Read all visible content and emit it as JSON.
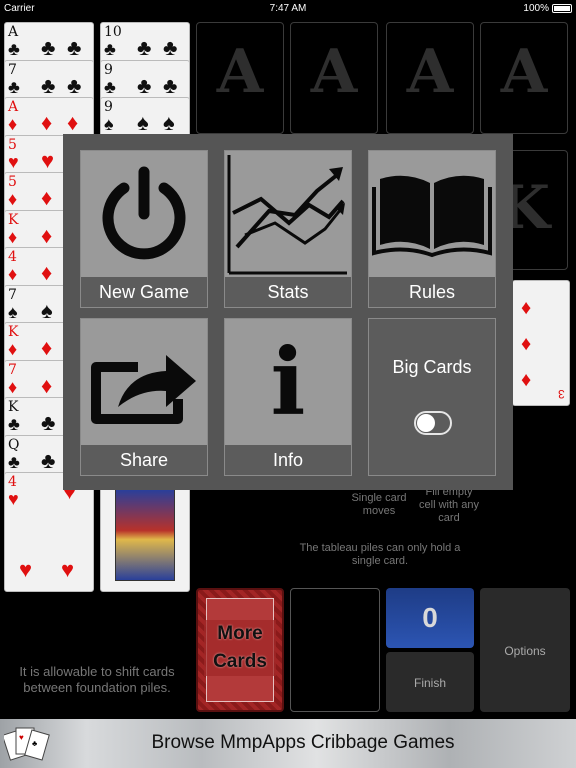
{
  "status_bar": {
    "carrier": "Carrier",
    "time": "7:47 AM",
    "battery": "100%"
  },
  "foundations": [
    "A",
    "A",
    "A",
    "A"
  ],
  "free_cells": [
    "K"
  ],
  "tableau": {
    "col1": [
      {
        "rank": "A",
        "suit": "♣",
        "color": "blk"
      },
      {
        "rank": "7",
        "suit": "♣",
        "color": "blk"
      },
      {
        "rank": "A",
        "suit": "♦",
        "color": "red"
      },
      {
        "rank": "5",
        "suit": "♥",
        "color": "red"
      },
      {
        "rank": "5",
        "suit": "♦",
        "color": "red"
      },
      {
        "rank": "K",
        "suit": "♦",
        "color": "red"
      },
      {
        "rank": "4",
        "suit": "♦",
        "color": "red"
      },
      {
        "rank": "7",
        "suit": "♠",
        "color": "blk"
      },
      {
        "rank": "K",
        "suit": "♦",
        "color": "red"
      },
      {
        "rank": "7",
        "suit": "♦",
        "color": "red"
      },
      {
        "rank": "K",
        "suit": "♣",
        "color": "blk"
      },
      {
        "rank": "Q",
        "suit": "♣",
        "color": "blk"
      },
      {
        "rank": "4",
        "suit": "♥",
        "color": "red"
      }
    ],
    "col2": [
      {
        "rank": "10",
        "suit": "♣",
        "color": "blk"
      },
      {
        "rank": "9",
        "suit": "♣",
        "color": "blk"
      },
      {
        "rank": "9",
        "suit": "♠",
        "color": "blk"
      }
    ],
    "right_card": {
      "rank": "3",
      "suit": "♦",
      "color": "red"
    }
  },
  "hints": {
    "single_card_moves": "Single card moves",
    "fill_empty": "Fill empty cell with any card",
    "tableau_rule": "The tableau piles can only hold a single card.",
    "foundation_shift": "It is allowable to shift cards between foundation piles."
  },
  "controls": {
    "more_cards": "More Cards",
    "score": "0",
    "finish": "Finish",
    "options": "Options"
  },
  "menu": {
    "new_game": "New Game",
    "stats": "Stats",
    "rules": "Rules",
    "share": "Share",
    "info": "Info",
    "big_cards": "Big Cards",
    "big_cards_on": false
  },
  "banner": {
    "text": "Browse MmpApps Cribbage Games"
  }
}
